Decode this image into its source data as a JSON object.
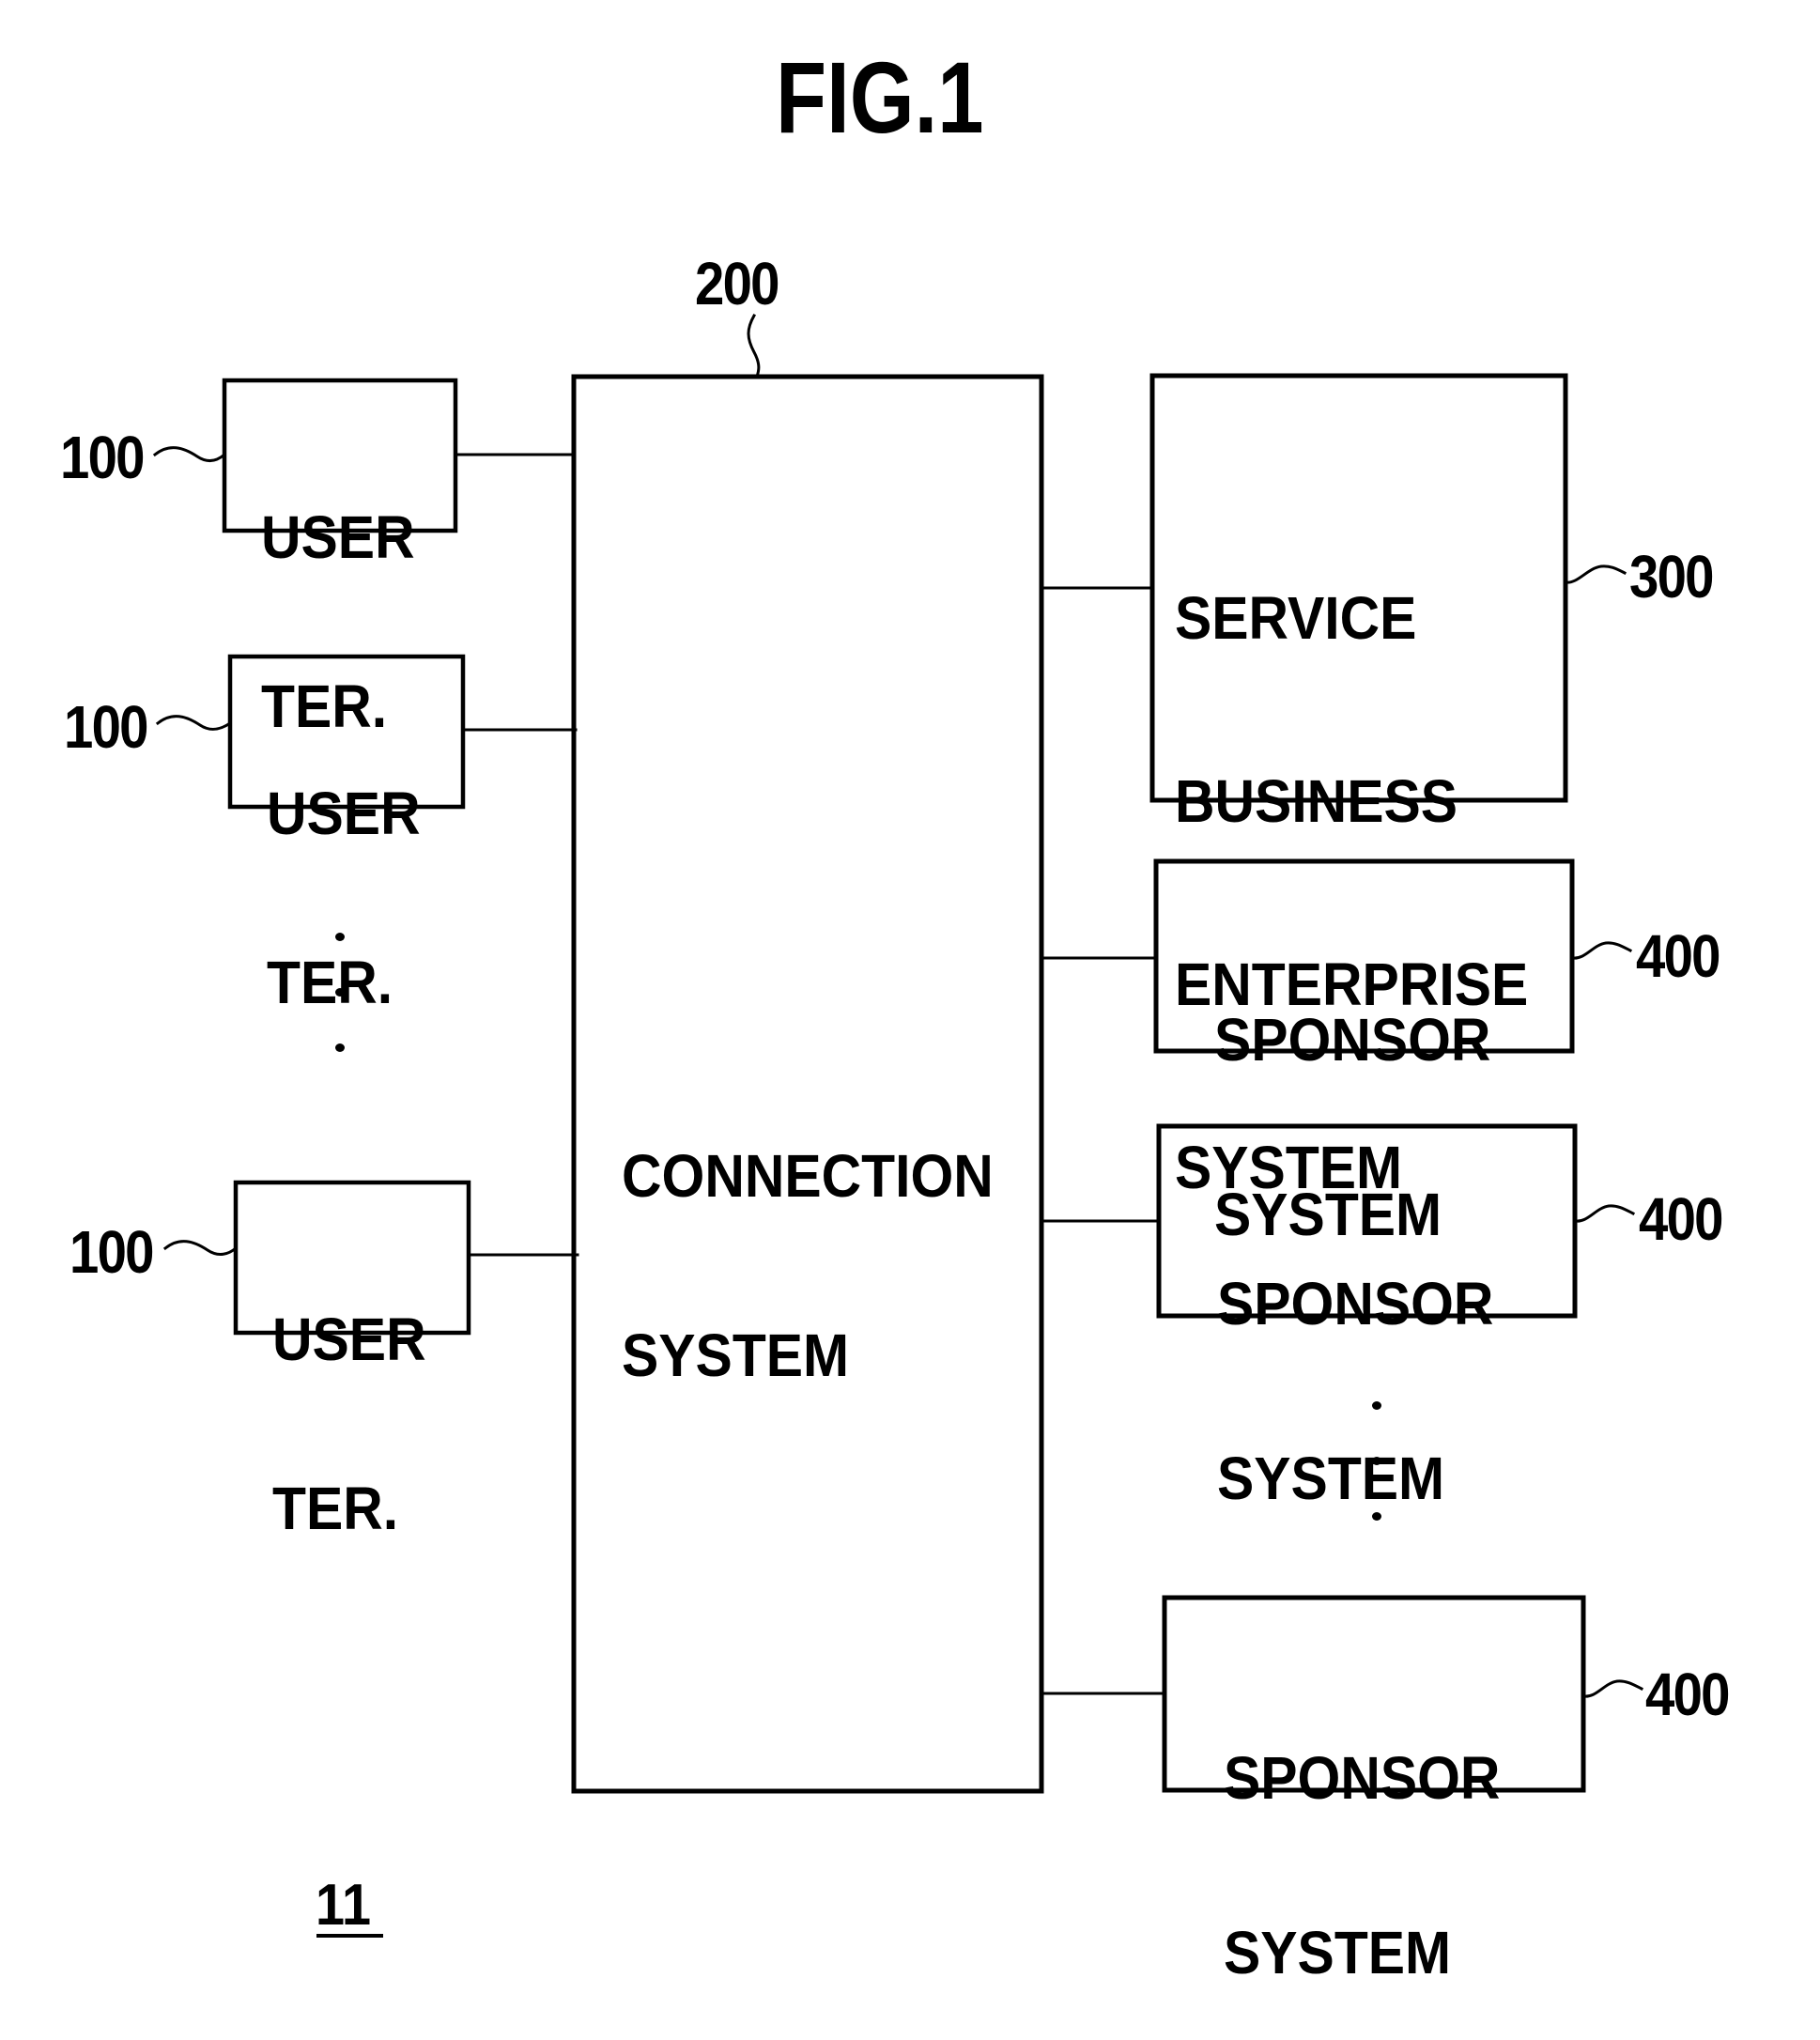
{
  "figure": {
    "title": "FIG.1",
    "system_number": "11"
  },
  "connection_system": {
    "ref": "200",
    "label_lines": [
      "CONNECTION",
      "SYSTEM"
    ]
  },
  "user_terminals": [
    {
      "ref": "100",
      "label_lines": [
        "USER",
        "TER."
      ]
    },
    {
      "ref": "100",
      "label_lines": [
        "USER",
        "TER."
      ]
    },
    {
      "ref": "100",
      "label_lines": [
        "USER",
        "TER."
      ]
    }
  ],
  "service_system": {
    "ref": "300",
    "label_lines": [
      "SERVICE",
      "BUSINESS",
      "ENTERPRISE",
      "SYSTEM"
    ]
  },
  "sponsor_systems": [
    {
      "ref": "400",
      "label_lines": [
        "SPONSOR",
        "SYSTEM"
      ]
    },
    {
      "ref": "400",
      "label_lines": [
        "SPONSOR",
        "SYSTEM"
      ]
    },
    {
      "ref": "400",
      "label_lines": [
        "SPONSOR",
        "SYSTEM"
      ]
    }
  ],
  "ellipsis": {
    "user_terminals_continued": "...",
    "sponsor_systems_continued": "..."
  }
}
